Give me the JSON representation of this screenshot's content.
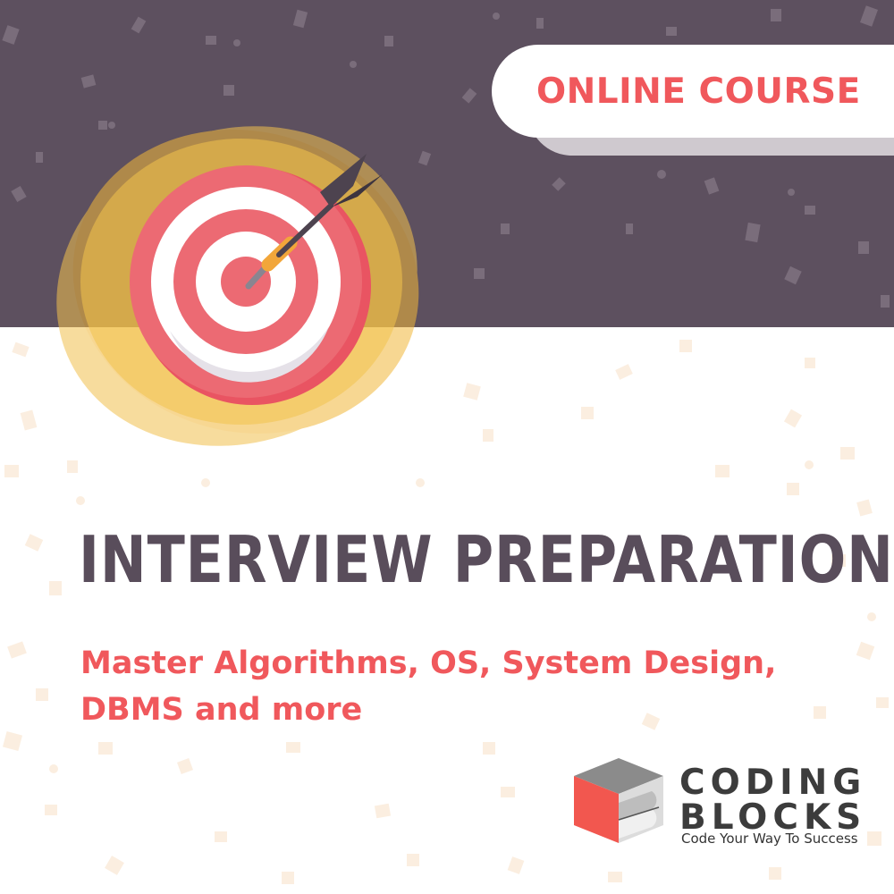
{
  "badge": {
    "label": "ONLINE COURSE"
  },
  "headline": {
    "title": "INTERVIEW PREPARATION"
  },
  "subtitle": {
    "line1": "Master Algorithms, OS, System Design,",
    "line2": "DBMS and more"
  },
  "brand": {
    "word1": "CODING",
    "word2": "BLOCKS",
    "tagline": "Code Your Way To Success"
  },
  "icons": {
    "target": "bullseye-target-icon",
    "dart": "dart-arrow-icon",
    "logo": "coding-blocks-cube-logo"
  },
  "colors": {
    "band": "#5d505f",
    "accent": "#f0585c",
    "title": "#594d5b",
    "glow": "#f2c14e"
  }
}
